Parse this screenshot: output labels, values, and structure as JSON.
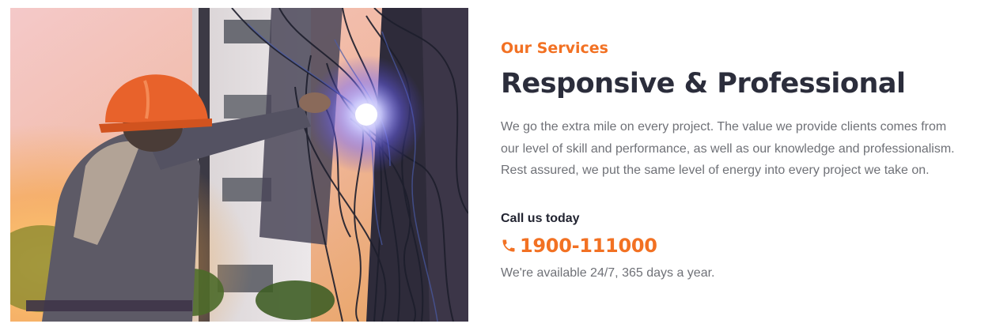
{
  "services": {
    "eyebrow": "Our Services",
    "title": "Responsive & Professional",
    "description": "We go the extra mile on every project. The value we provide clients comes from our level of skill and performance, as well as our knowledge and professionalism. Rest assured, we put the same level of energy into every project we take on.",
    "call_label": "Call us today",
    "phone_number": "1900-111000",
    "availability": "We're available 24/7, 365 days a year.",
    "phone_icon": "phone-icon",
    "photo_subject": "electrician-working-on-cables-photo"
  },
  "colors": {
    "accent": "#f27123",
    "heading": "#2b2d3b",
    "body_text": "#6f7177"
  }
}
